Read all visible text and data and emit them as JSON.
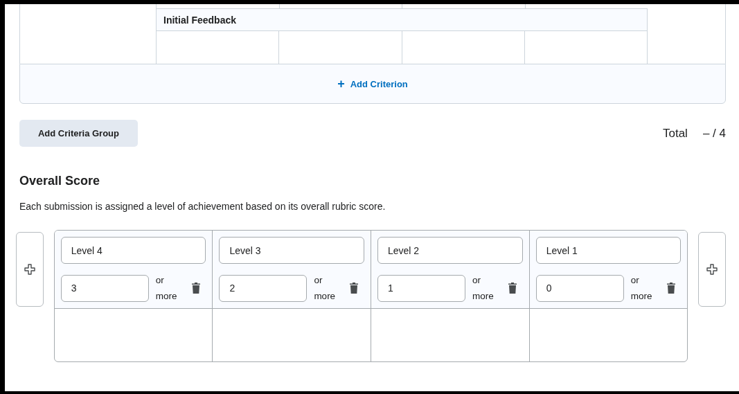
{
  "criterion": {
    "name": "Initial Feedback"
  },
  "add_criterion": {
    "icon": "+",
    "label": "Add Criterion"
  },
  "add_criteria_group": "Add Criteria Group",
  "total": {
    "label": "Total",
    "value": "– / 4"
  },
  "overall_score": {
    "title": "Overall Score",
    "description": "Each submission is assigned a level of achievement based on its overall rubric score.",
    "levels": [
      {
        "name": "Level 4",
        "threshold": "3",
        "suffix": "or more"
      },
      {
        "name": "Level 3",
        "threshold": "2",
        "suffix": "or more"
      },
      {
        "name": "Level 2",
        "threshold": "1",
        "suffix": "or more"
      },
      {
        "name": "Level 1",
        "threshold": "0",
        "suffix": "or more"
      }
    ]
  }
}
